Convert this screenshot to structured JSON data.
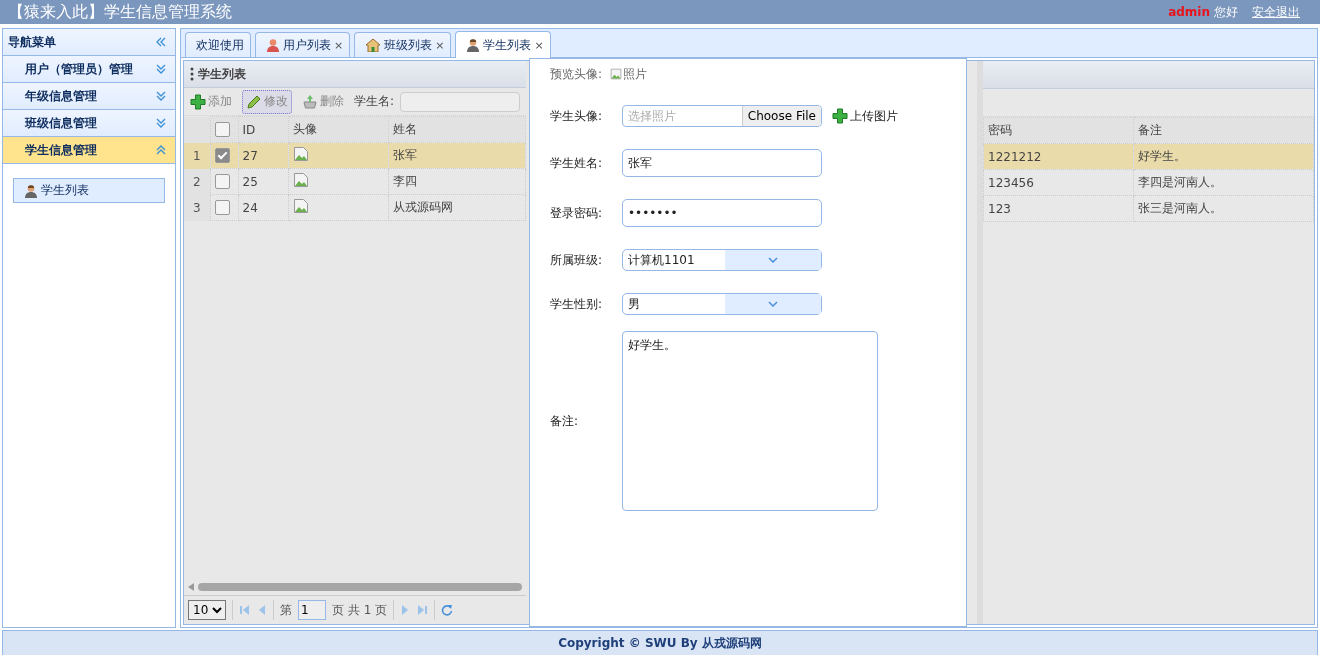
{
  "header": {
    "title": "【猿来入此】学生信息管理系统",
    "user": "admin",
    "greeting": "您好",
    "logout": "安全退出"
  },
  "sidebar": {
    "title": "导航菜单",
    "sections": [
      {
        "label": "用户（管理员）管理",
        "expanded": false
      },
      {
        "label": "年级信息管理",
        "expanded": false
      },
      {
        "label": "班级信息管理",
        "expanded": false
      },
      {
        "label": "学生信息管理",
        "expanded": true,
        "children": [
          {
            "label": "学生列表",
            "selected": true
          }
        ]
      }
    ]
  },
  "tabs": [
    {
      "label": "欢迎使用",
      "selected": false
    },
    {
      "label": "用户列表",
      "close": "×",
      "selected": false
    },
    {
      "label": "班级列表",
      "close": "×",
      "selected": false
    },
    {
      "label": "学生列表",
      "close": "×",
      "selected": true
    }
  ],
  "grid": {
    "title": "学生列表",
    "toolbar": [
      {
        "kind": "add",
        "label": "添加",
        "focused": false
      },
      {
        "kind": "edit",
        "label": "修改",
        "focused": true
      },
      {
        "kind": "delete",
        "label": "删除",
        "focused": false
      }
    ],
    "search_label": "学生名:",
    "all_checked": false,
    "columns": [
      "ID",
      "头像",
      "姓名",
      "密码",
      "备注"
    ],
    "rows": [
      {
        "number": "1",
        "checked": true,
        "selected": true,
        "id": "27",
        "name": "张军",
        "password": "1221212",
        "remark": "好学生。"
      },
      {
        "number": "2",
        "checked": false,
        "selected": false,
        "id": "25",
        "name": "李四",
        "password": "123456",
        "remark": "李四是河南人。"
      },
      {
        "number": "3",
        "checked": false,
        "selected": false,
        "id": "24",
        "name": "从戎源码网",
        "password": "123",
        "remark": "张三是河南人。"
      }
    ],
    "pager": {
      "page_size": "10",
      "before": "第",
      "page": "1",
      "after": "页 共 1 页"
    }
  },
  "dialog": {
    "preview_label": "预览头像:",
    "preview_alt": "照片",
    "fields": [
      {
        "kind": "file",
        "label": "学生头像:",
        "placeholder": "选择照片",
        "button": "Choose File",
        "action": "上传图片"
      },
      {
        "kind": "text",
        "label": "学生姓名:",
        "value": "张军"
      },
      {
        "kind": "text",
        "label": "登录密码:",
        "value": "•••••••"
      },
      {
        "kind": "select",
        "label": "所属班级:",
        "value": "计算机1101"
      },
      {
        "kind": "select",
        "label": "学生性别:",
        "value": "男"
      },
      {
        "kind": "textarea",
        "label": "备注:",
        "value": "好学生。"
      }
    ]
  },
  "footer": {
    "text": "Copyright © SWU By 从戎源码网"
  }
}
